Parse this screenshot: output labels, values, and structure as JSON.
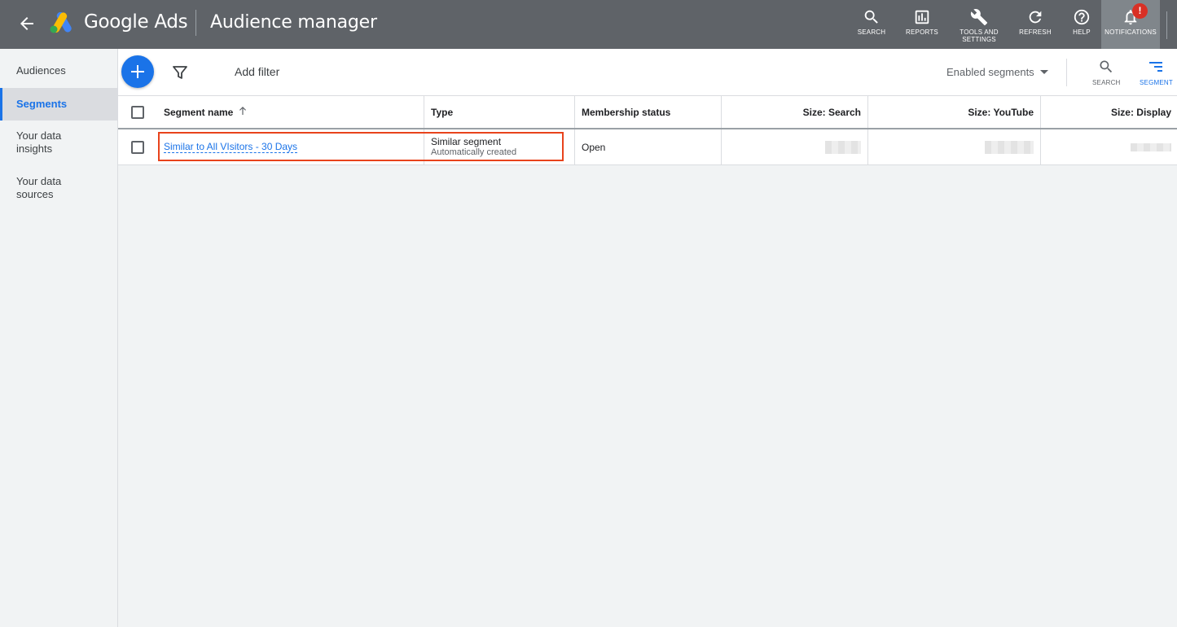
{
  "header": {
    "brand": "Google Ads",
    "title": "Audience manager",
    "actions": [
      {
        "id": "search",
        "label": "SEARCH"
      },
      {
        "id": "reports",
        "label": "REPORTS"
      },
      {
        "id": "tools",
        "label": "TOOLS AND SETTINGS"
      },
      {
        "id": "refresh",
        "label": "REFRESH"
      },
      {
        "id": "help",
        "label": "HELP"
      },
      {
        "id": "notifications",
        "label": "NOTIFICATIONS",
        "badge": "!"
      }
    ]
  },
  "sidebar": {
    "items": [
      {
        "label": "Audiences",
        "active": false
      },
      {
        "label": "Segments",
        "active": true
      },
      {
        "label": "Your data insights",
        "active": false
      },
      {
        "label": "Your data sources",
        "active": false
      }
    ]
  },
  "toolbar": {
    "add_filter": "Add filter",
    "segment_filter": "Enabled segments",
    "search_label": "SEARCH",
    "segment_label": "SEGMENT"
  },
  "table": {
    "columns": [
      "Segment name",
      "Type",
      "Membership status",
      "Size: Search",
      "Size: YouTube",
      "Size: Display"
    ],
    "rows": [
      {
        "name": "Similar to All VIsitors - 30 Days",
        "type_main": "Similar segment",
        "type_sub": "Automatically created",
        "status": "Open"
      }
    ]
  },
  "colors": {
    "topbar": "#5f6368",
    "accent": "#1a73e8",
    "highlight": "#e8431c",
    "badge": "#d93025"
  }
}
